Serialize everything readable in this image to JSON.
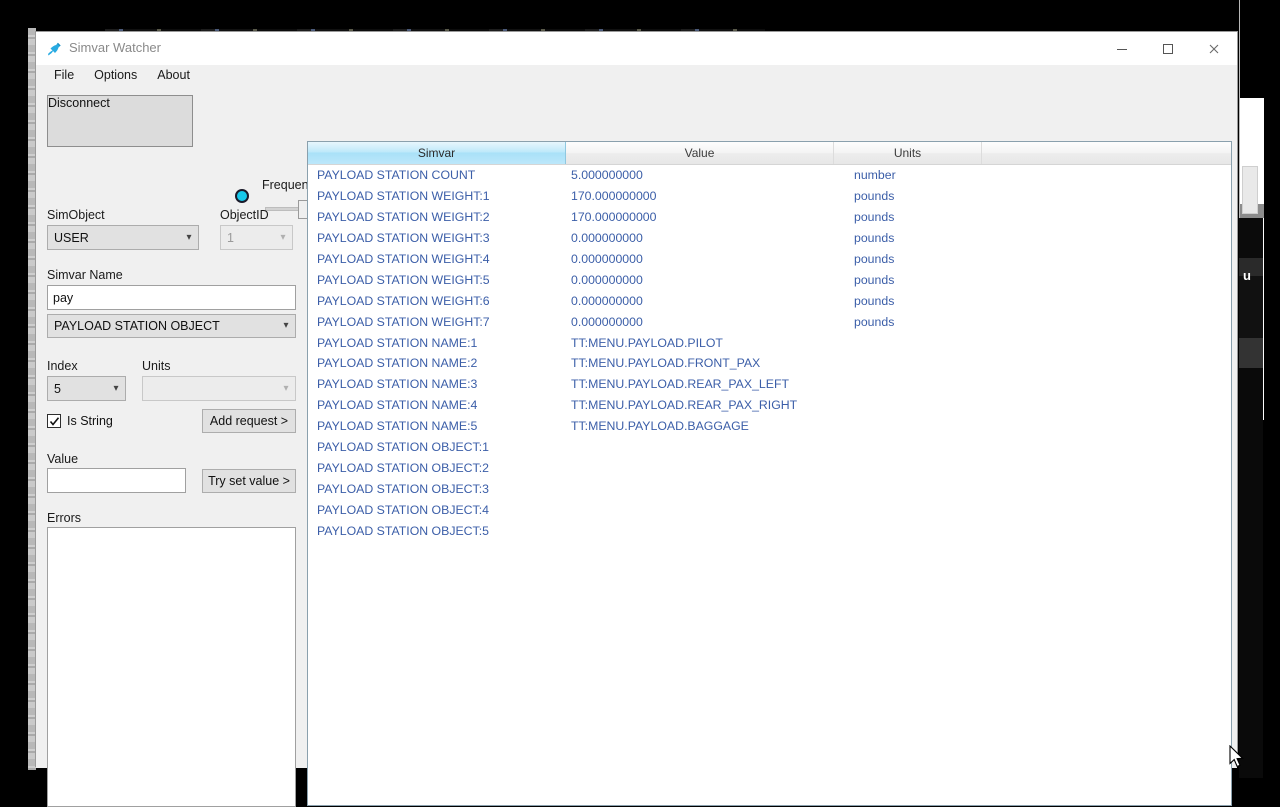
{
  "window": {
    "title": "Simvar Watcher",
    "icon": "plug-icon",
    "controls": {
      "minimize": "minimize-icon",
      "maximize": "maximize-icon",
      "close": "close-icon"
    }
  },
  "menubar": {
    "items": [
      "File",
      "Options",
      "About"
    ]
  },
  "left_panel": {
    "connect_button": "Disconnect",
    "status_led": {
      "name": "connection-led",
      "color": "#17c8ea"
    },
    "frequency_label": "Frequency",
    "simobject_label": "SimObject",
    "simobject_value": "USER",
    "objectid_label": "ObjectID",
    "objectid_value": "1",
    "simvar_name_label": "Simvar Name",
    "simvar_name_value": "pay",
    "simvar_suggestion_value": "PAYLOAD STATION OBJECT",
    "index_label": "Index",
    "index_value": "5",
    "units_label": "Units",
    "units_value": "",
    "is_string_label": "Is String",
    "is_string_checked": true,
    "add_request_button": "Add request >",
    "value_label": "Value",
    "value_input": "",
    "try_set_value_button": "Try set value >",
    "errors_label": "Errors",
    "errors_content": ""
  },
  "table": {
    "columns": [
      "Simvar",
      "Value",
      "Units",
      ""
    ],
    "selected_column": "Simvar",
    "rows": [
      {
        "simvar": "PAYLOAD STATION COUNT",
        "value": "5.000000000",
        "units": "number"
      },
      {
        "simvar": "PAYLOAD STATION WEIGHT:1",
        "value": "170.000000000",
        "units": "pounds"
      },
      {
        "simvar": "PAYLOAD STATION WEIGHT:2",
        "value": "170.000000000",
        "units": "pounds"
      },
      {
        "simvar": "PAYLOAD STATION WEIGHT:3",
        "value": "0.000000000",
        "units": "pounds"
      },
      {
        "simvar": "PAYLOAD STATION WEIGHT:4",
        "value": "0.000000000",
        "units": "pounds"
      },
      {
        "simvar": "PAYLOAD STATION WEIGHT:5",
        "value": "0.000000000",
        "units": "pounds"
      },
      {
        "simvar": "PAYLOAD STATION WEIGHT:6",
        "value": "0.000000000",
        "units": "pounds"
      },
      {
        "simvar": "PAYLOAD STATION WEIGHT:7",
        "value": "0.000000000",
        "units": "pounds"
      },
      {
        "simvar": "PAYLOAD STATION NAME:1",
        "value": "TT:MENU.PAYLOAD.PILOT",
        "units": ""
      },
      {
        "simvar": "PAYLOAD STATION NAME:2",
        "value": "TT:MENU.PAYLOAD.FRONT_PAX",
        "units": ""
      },
      {
        "simvar": "PAYLOAD STATION NAME:3",
        "value": "TT:MENU.PAYLOAD.REAR_PAX_LEFT",
        "units": ""
      },
      {
        "simvar": "PAYLOAD STATION NAME:4",
        "value": "TT:MENU.PAYLOAD.REAR_PAX_RIGHT",
        "units": ""
      },
      {
        "simvar": "PAYLOAD STATION NAME:5",
        "value": "TT:MENU.PAYLOAD.BAGGAGE",
        "units": ""
      },
      {
        "simvar": "PAYLOAD STATION OBJECT:1",
        "value": "",
        "units": ""
      },
      {
        "simvar": "PAYLOAD STATION OBJECT:2",
        "value": "",
        "units": ""
      },
      {
        "simvar": "PAYLOAD STATION OBJECT:3",
        "value": "",
        "units": ""
      },
      {
        "simvar": "PAYLOAD STATION OBJECT:4",
        "value": "",
        "units": ""
      },
      {
        "simvar": "PAYLOAD STATION OBJECT:5",
        "value": "",
        "units": ""
      }
    ]
  },
  "colors": {
    "row_text": "#3b5ea8",
    "header_selected": "#bfe9fa",
    "led": "#17c8ea",
    "window_bg": "#f0f0f0"
  },
  "background_right_text": "u"
}
